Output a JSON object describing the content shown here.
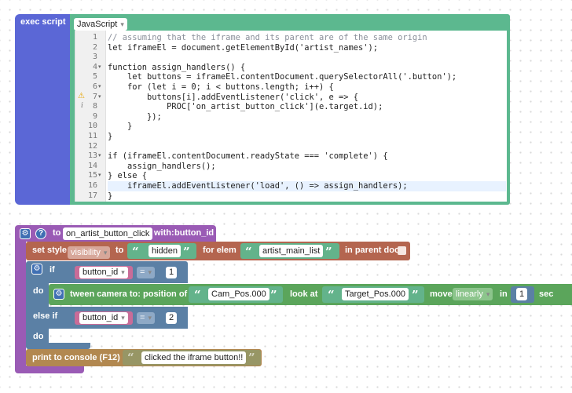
{
  "exec_block": {
    "label": "exec script",
    "language": "JavaScript",
    "code_lines": [
      {
        "n": "1",
        "text": "// assuming that the iframe and its parent are of the same origin",
        "kind": "comment"
      },
      {
        "n": "2",
        "text": "let iframeEl = document.getElementById('artist_names');"
      },
      {
        "n": "3",
        "text": ""
      },
      {
        "n": "4",
        "text": "function assign_handlers() {"
      },
      {
        "n": "5",
        "text": "    let buttons = iframeEl.contentDocument.querySelectorAll('.button');"
      },
      {
        "n": "6",
        "text": "    for (let i = 0; i < buttons.length; i++) {"
      },
      {
        "n": "7",
        "text": "        buttons[i].addEventListener('click', e => {"
      },
      {
        "n": "8",
        "text": "            PROC['on_artist_button_click'](e.target.id);"
      },
      {
        "n": "9",
        "text": "        });"
      },
      {
        "n": "10",
        "text": "    }"
      },
      {
        "n": "11",
        "text": "}"
      },
      {
        "n": "12",
        "text": ""
      },
      {
        "n": "13",
        "text": "if (iframeEl.contentDocument.readyState === 'complete') {"
      },
      {
        "n": "14",
        "text": "    assign_handlers();"
      },
      {
        "n": "15",
        "text": "} else {"
      },
      {
        "n": "16",
        "text": "    iframeEl.addEventListener('load', () => assign_handlers);"
      },
      {
        "n": "17",
        "text": "}"
      }
    ]
  },
  "proc_block": {
    "to": "to",
    "name": "on_artist_button_click",
    "with": "with:",
    "param": "button_id"
  },
  "set_style": {
    "label": "set style",
    "property": "visibility",
    "to": "to",
    "value": "hidden",
    "for_elem": "for elem",
    "elem": "artist_main_list",
    "in_parent": "in parent doc"
  },
  "if_block": {
    "if": "if",
    "do": "do",
    "else_if": "else if",
    "do2": "do",
    "cond1_var": "button_id",
    "cond1_op": "=",
    "cond1_val": "1",
    "cond2_var": "button_id",
    "cond2_op": "=",
    "cond2_val": "2"
  },
  "tween": {
    "label": "tween camera to:",
    "position_of": "position of",
    "pos": "Cam_Pos.000",
    "look_at": "look at",
    "target": "Target_Pos.000",
    "move": "move",
    "easing": "linearly",
    "in": "in",
    "seconds": "1",
    "sec": "sec"
  },
  "print": {
    "label": "print to console (F12)",
    "text": "clicked the iframe button!!"
  },
  "quote_open": "“",
  "quote_close": "”",
  "colors": {
    "proc": "#9a5bb5",
    "exec": "#5b67d6",
    "code_frame": "#5cb88f",
    "style": "#b4654f",
    "logic": "#5b80a5",
    "tween": "#5ba55b",
    "text": "#63b38b",
    "print": "#b28850",
    "var": "#a5745b",
    "var_pink": "#c96c98"
  }
}
